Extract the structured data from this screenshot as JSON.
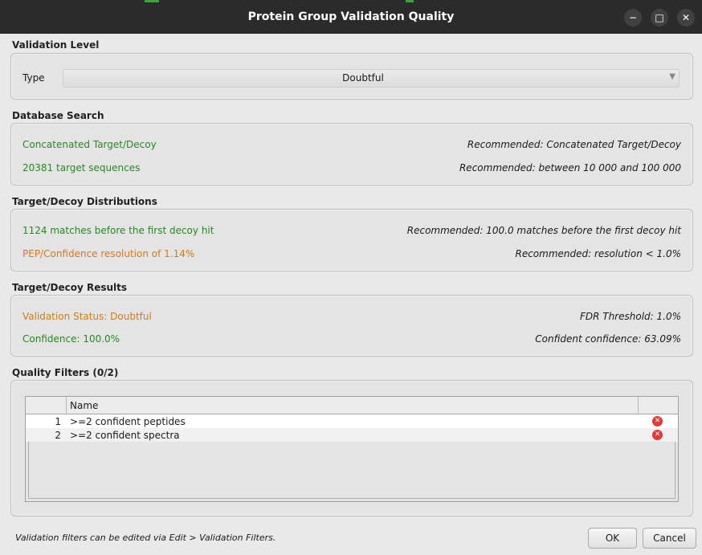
{
  "window": {
    "title": "Protein Group Validation Quality",
    "controls": {
      "minimize": "−",
      "maximize": "□",
      "close": "✕"
    }
  },
  "validation_level": {
    "title": "Validation Level",
    "type_label": "Type",
    "type_value": "Doubtful"
  },
  "database_search": {
    "title": "Database Search",
    "rows": [
      {
        "left": "Concatenated Target/Decoy",
        "right": "Recommended: Concatenated Target/Decoy",
        "status": "good"
      },
      {
        "left": "20381 target sequences",
        "right": "Recommended: between 10 000 and 100 000",
        "status": "good"
      }
    ]
  },
  "target_decoy_distributions": {
    "title": "Target/Decoy Distributions",
    "rows": [
      {
        "left": "1124 matches before the first decoy hit",
        "right": "Recommended: 100.0 matches before the first decoy hit",
        "status": "good"
      },
      {
        "left": "PEP/Confidence resolution of 1.14%",
        "right": "Recommended: resolution < 1.0%",
        "status": "warn"
      }
    ]
  },
  "target_decoy_results": {
    "title": "Target/Decoy Results",
    "rows": [
      {
        "left": "Validation Status: Doubtful",
        "right": "FDR Threshold: 1.0%",
        "status": "warn"
      },
      {
        "left": "Confidence: 100.0%",
        "right": "Confident confidence: 63.09%",
        "status": "good"
      }
    ]
  },
  "quality_filters": {
    "title": "Quality Filters (0/2)",
    "columns": [
      "",
      "Name",
      ""
    ],
    "rows": [
      {
        "index": "1",
        "name": ">=2 confident peptides",
        "icon": "remove-icon"
      },
      {
        "index": "2",
        "name": ">=2 confident spectra",
        "icon": "remove-icon"
      }
    ]
  },
  "footer": {
    "note": "Validation filters can be edited via Edit > Validation Filters.",
    "ok_label": "OK",
    "cancel_label": "Cancel"
  },
  "colors": {
    "good": "#258a1f",
    "warn": "#d97a12",
    "titlebar": "#2b2b2b"
  }
}
